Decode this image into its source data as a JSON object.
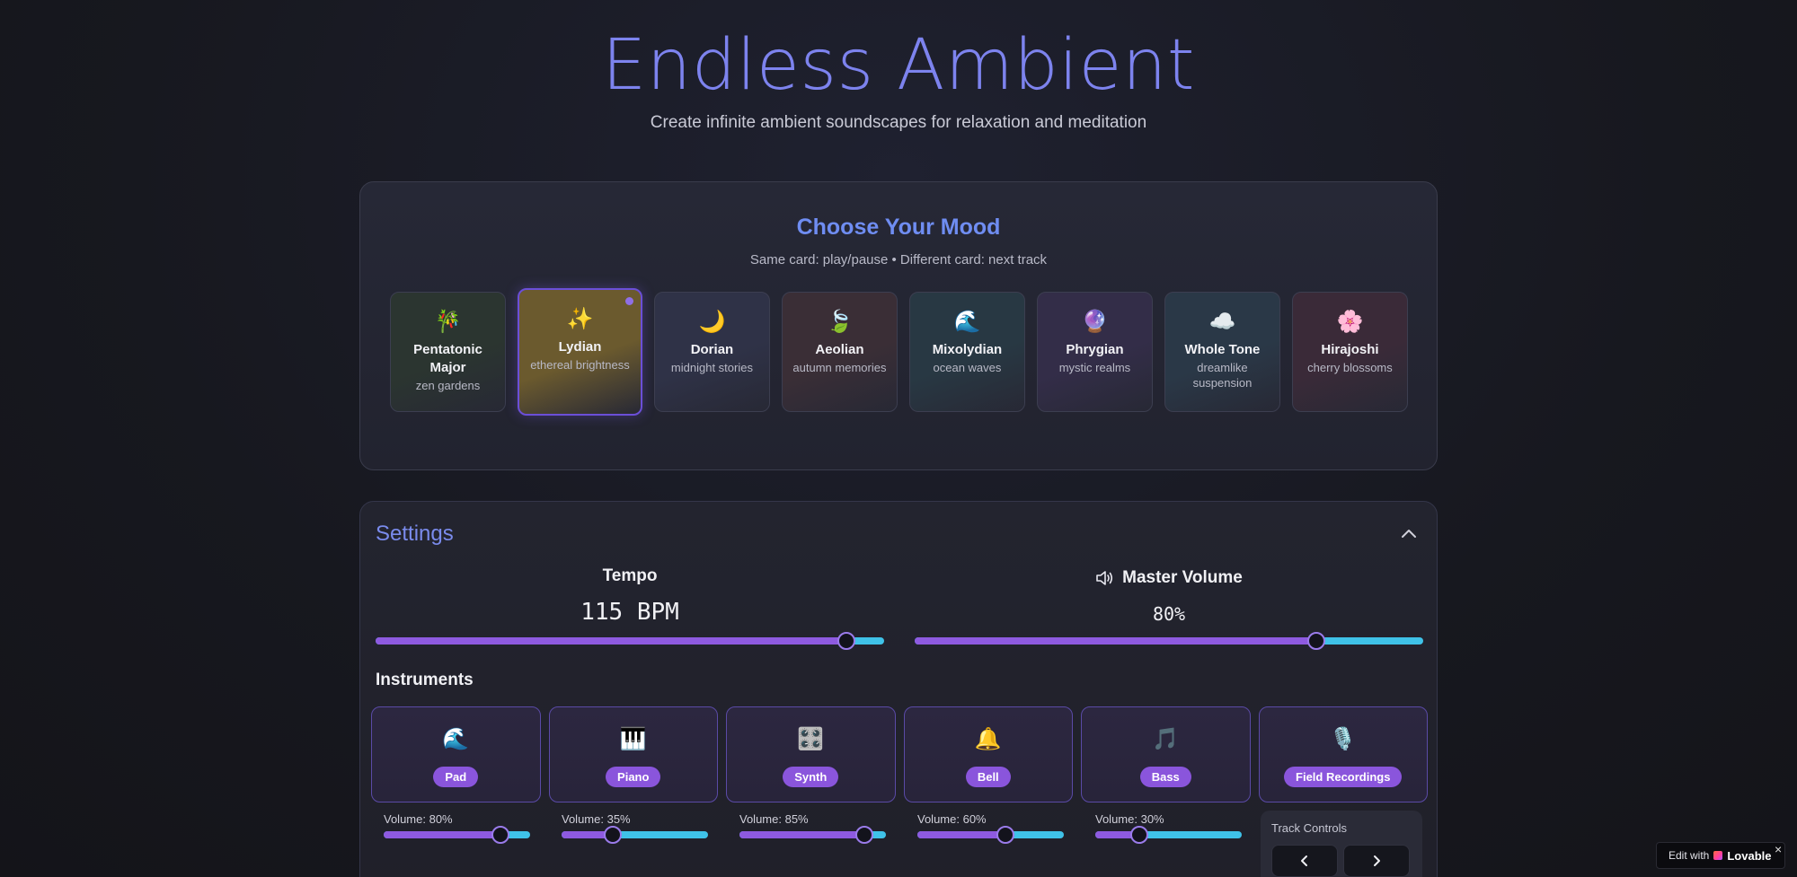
{
  "header": {
    "title": "Endless Ambient",
    "subtitle": "Create infinite ambient soundscapes for relaxation and meditation"
  },
  "mood": {
    "title": "Choose Your Mood",
    "hint": "Same card: play/pause • Different card: next track",
    "cards": [
      {
        "emoji": "🎋",
        "name": "Pentatonic Major",
        "desc": "zen gardens",
        "bg": "#2b3530",
        "active": false
      },
      {
        "emoji": "✨",
        "name": "Lydian",
        "desc": "ethereal brightness",
        "bg": "#6b5a2e",
        "active": true
      },
      {
        "emoji": "🌙",
        "name": "Dorian",
        "desc": "midnight stories",
        "bg": "#2f3247",
        "active": false
      },
      {
        "emoji": "🍃",
        "name": "Aeolian",
        "desc": "autumn memories",
        "bg": "#3a2e36",
        "active": false
      },
      {
        "emoji": "🌊",
        "name": "Mixolydian",
        "desc": "ocean waves",
        "bg": "#283843",
        "active": false
      },
      {
        "emoji": "🔮",
        "name": "Phrygian",
        "desc": "mystic realms",
        "bg": "#332d48",
        "active": false
      },
      {
        "emoji": "☁️",
        "name": "Whole Tone",
        "desc": "dreamlike suspension",
        "bg": "#2a3847",
        "active": false
      },
      {
        "emoji": "🌸",
        "name": "Hirajoshi",
        "desc": "cherry blossoms",
        "bg": "#3a2a38",
        "active": false
      }
    ]
  },
  "settings": {
    "title": "Settings",
    "tempo_label": "Tempo",
    "tempo_value": "115 BPM",
    "tempo_fraction": 0.925,
    "volume_label": "Master Volume",
    "volume_value": "80%",
    "volume_fraction": 0.79,
    "instruments_title": "Instruments",
    "instruments": [
      {
        "emoji": "🌊",
        "name": "Pad",
        "volume_text": "Volume: 80%",
        "volume": 0.8
      },
      {
        "emoji": "🎹",
        "name": "Piano",
        "volume_text": "Volume: 35%",
        "volume": 0.35
      },
      {
        "emoji": "🎛️",
        "name": "Synth",
        "volume_text": "Volume: 85%",
        "volume": 0.85
      },
      {
        "emoji": "🔔",
        "name": "Bell",
        "volume_text": "Volume: 60%",
        "volume": 0.6
      },
      {
        "emoji": "🎵",
        "name": "Bass",
        "volume_text": "Volume: 30%",
        "volume": 0.3
      },
      {
        "emoji": "🎙️",
        "name": "Field Recordings"
      }
    ],
    "track_controls_label": "Track Controls"
  },
  "badge": {
    "prefix": "Edit with",
    "brand": "Lovable",
    "close": "×"
  },
  "icons": {
    "collapse": "chevron-up-icon",
    "volume": "speaker-icon",
    "prev": "chevron-left-icon",
    "next": "chevron-right-icon"
  }
}
